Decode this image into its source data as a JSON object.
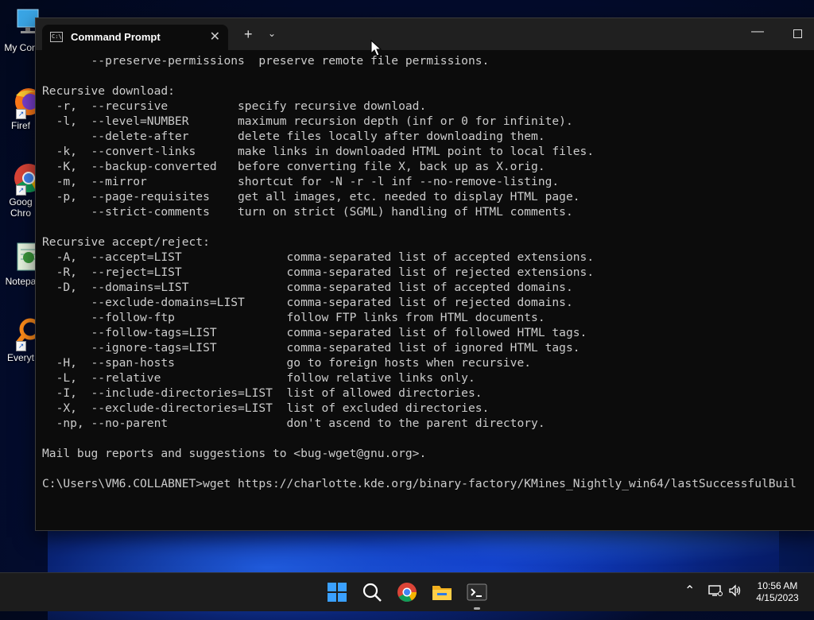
{
  "desktop": {
    "icons": [
      {
        "label": "My Con",
        "icon": "computer-icon"
      },
      {
        "label": "Firef",
        "icon": "firefox-icon"
      },
      {
        "label": "Goog Chro",
        "icon": "chrome-icon"
      },
      {
        "label": "Notepa",
        "icon": "notepad-icon"
      },
      {
        "label": "Everyt",
        "icon": "everything-search-icon"
      }
    ]
  },
  "window": {
    "tab_title": "Command Prompt",
    "tab_icon_text": "C:\\",
    "close_glyph": "✕",
    "new_tab_glyph": "+",
    "dropdown_glyph": "⌄",
    "minimize_glyph": "—"
  },
  "console_lines": [
    "       --preserve-permissions  preserve remote file permissions.",
    "",
    "Recursive download:",
    "  -r,  --recursive          specify recursive download.",
    "  -l,  --level=NUMBER       maximum recursion depth (inf or 0 for infinite).",
    "       --delete-after       delete files locally after downloading them.",
    "  -k,  --convert-links      make links in downloaded HTML point to local files.",
    "  -K,  --backup-converted   before converting file X, back up as X.orig.",
    "  -m,  --mirror             shortcut for -N -r -l inf --no-remove-listing.",
    "  -p,  --page-requisites    get all images, etc. needed to display HTML page.",
    "       --strict-comments    turn on strict (SGML) handling of HTML comments.",
    "",
    "Recursive accept/reject:",
    "  -A,  --accept=LIST               comma-separated list of accepted extensions.",
    "  -R,  --reject=LIST               comma-separated list of rejected extensions.",
    "  -D,  --domains=LIST              comma-separated list of accepted domains.",
    "       --exclude-domains=LIST      comma-separated list of rejected domains.",
    "       --follow-ftp                follow FTP links from HTML documents.",
    "       --follow-tags=LIST          comma-separated list of followed HTML tags.",
    "       --ignore-tags=LIST          comma-separated list of ignored HTML tags.",
    "  -H,  --span-hosts                go to foreign hosts when recursive.",
    "  -L,  --relative                  follow relative links only.",
    "  -I,  --include-directories=LIST  list of allowed directories.",
    "  -X,  --exclude-directories=LIST  list of excluded directories.",
    "  -np, --no-parent                 don't ascend to the parent directory.",
    "",
    "Mail bug reports and suggestions to <bug-wget@gnu.org>.",
    "",
    "C:\\Users\\VM6.COLLABNET>wget https://charlotte.kde.org/binary-factory/KMines_Nightly_win64/lastSuccessfulBuil"
  ],
  "taskbar": {
    "apps": [
      {
        "name": "start-button",
        "icon": "windows-logo-icon"
      },
      {
        "name": "search-button",
        "icon": "search-icon"
      },
      {
        "name": "chrome-taskbar-button",
        "icon": "chrome-icon"
      },
      {
        "name": "file-explorer-taskbar-button",
        "icon": "folder-icon"
      },
      {
        "name": "terminal-taskbar-button",
        "icon": "terminal-icon"
      }
    ],
    "tray": {
      "chevron": "⌃",
      "time": "10:56 AM",
      "date": "4/15/2023"
    }
  },
  "colors": {
    "console_bg": "#0c0c0c",
    "console_fg": "#cccccc",
    "titlebar_bg": "#202020",
    "taskbar_bg": "#1c1c1c"
  }
}
